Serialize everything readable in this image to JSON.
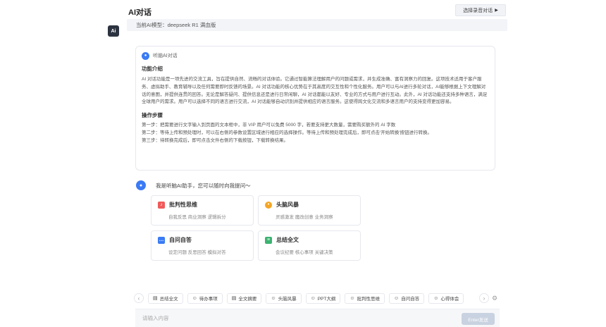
{
  "header": {
    "title": "AI对话",
    "model_label": "当前AI模型：deepseek R1 满血版",
    "switch_button": "选择录音对话",
    "avatar": "Ai"
  },
  "intro": {
    "assistant_name": "听脑AI对话",
    "section1_title": "功能介绍",
    "section1_text": "AI 对话功能是一项先进的交流工具，旨在提供自然、流畅的对话体验。它通过智能算法理解用户的问题或需求，并生成准确、富有洞察力的回复。这项技术适用于客户服务、虚拟助手、教育辅导以及任何需要即时反馈的场景。AI 对话功能的核心优势在于其高度的交互性和个性化服务。用户可以与AI进行多轮对话，AI能够根据上下文理解对话的意图，并提供连贯的回答。无论是解答疑问、提供信息还是进行日常闲聊，AI 对话都能以友好、专业的方式与用户进行互动。此外，AI 对话功能还支持多种语言，满足全球用户的需求。用户可以选择不同的语言进行交流，AI 对话能够自动识别并提供相应的语言服务。这使得跨文化交流和多语言用户的支持变得更加容易。",
    "section2_title": "操作步骤",
    "steps": [
      "第一步：把需要进行文字输入到页面的文本框中，非 VIP 用户可以免费 5000 字，若要支持更大数量，需要购买额外的 AI 字数",
      "第二步：等待上传和预处理时，可以在右侧的参数设置区域进行相应的选择操作。等待上传和预处理完成后，即可点击'开始转换'按钮进行转换。",
      "第三步：待转换完成后，即可点击文件右侧的下载按钮，下载转换结果。"
    ]
  },
  "greeting": "我是听脑AI助手，您可以随时向我提问～",
  "options": [
    {
      "title": "批判性思维",
      "sub": "自我反思  商业洞察  逻辑拆分",
      "icon": "bell-icon",
      "color": "#f05a5a"
    },
    {
      "title": "头脑风暴",
      "sub": "灵感激发  魔改创意  业务洞察",
      "icon": "bulb-icon",
      "color": "#f5a623"
    },
    {
      "title": "自问自答",
      "sub": "设定问题  反思回答  模拟对答",
      "icon": "chat-icon",
      "color": "#3a7bf5"
    },
    {
      "title": "总结全文",
      "sub": "会议纪要  核心事项  关键决策",
      "icon": "list-icon",
      "color": "#3cb371"
    }
  ],
  "toolbar_chips": [
    {
      "label": "总结全文",
      "icon": "doc-icon"
    },
    {
      "label": "待办事项",
      "icon": "emoji-icon"
    },
    {
      "label": "全文摘要",
      "icon": "doc-icon"
    },
    {
      "label": "头脑风暴",
      "icon": "emoji-icon"
    },
    {
      "label": "PPT大纲",
      "icon": "emoji-icon"
    },
    {
      "label": "批判性思维",
      "icon": "emoji-icon"
    },
    {
      "label": "自问自答",
      "icon": "emoji-icon"
    },
    {
      "label": "心得体会",
      "icon": "emoji-icon"
    }
  ],
  "input": {
    "placeholder": "请输入内容",
    "send_label": "Enter发送"
  }
}
